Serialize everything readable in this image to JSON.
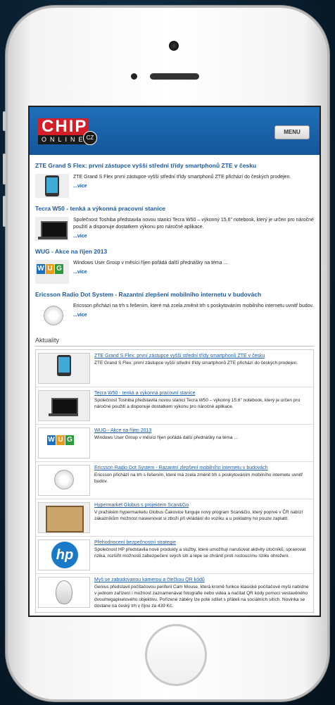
{
  "header": {
    "logo_main": "CHIP",
    "logo_sub": "ONLINE",
    "logo_badge": "CZ",
    "menu_label": "MENU"
  },
  "featured": [
    {
      "title": "ZTE Grand S Flex: první zástupce vyšší střední třídy smartphonů ZTE v česku",
      "text": "ZTE Grand S Flex první zástupce vyšší střední třídy smartphonů ZTE přichází do českých prodejen.",
      "more": "...více",
      "icon": "phone-image"
    },
    {
      "title": "Tecra W50 - tenká a výkonná pracovní stanice",
      "text": "Společnost Toshiba představila novou stanici Tecra W50 – výkonný 15.6\" notebook, který je určen pro náročné použití a disponuje dostatkem výkonu pro náročné aplikace.",
      "more": "...více",
      "icon": "laptop-image"
    },
    {
      "title": "WUG - Akce na říjen 2013",
      "text": "Windows User Group v měsíci říjen pořádá další přednášky na téma ...",
      "more": "...více",
      "icon": "wug-logo"
    },
    {
      "title": "Ericsson Radio Dot System - Razantní zlepšení mobilního internetu v budovách",
      "text": "Ericsson přichází na trh s řešením, které má zcela změnit trh s poskytováním mobilního internetu uvnitř budov.",
      "more": "...více",
      "icon": "radio-dot-image"
    }
  ],
  "aktuality": {
    "heading": "Aktuality",
    "items": [
      {
        "title": "ZTE Grand S Flex: první zástupce vyšší střední třídy smartphonů ZTE v česku",
        "text": "ZTE Grand S Flex: první zástupce vyšší střední třídy smartphonů ZTE přichází do českých prodejen.",
        "icon": "phone-image"
      },
      {
        "title": "Tecra W50 - tenká a výkonná pracovní stanice",
        "text": "Společnost Toshiba představila novou stanici Tecra W50 – výkonný 15.6\" notebook, který je určen pro náročné použití a disponuje dostatkem výkonu pro náročné aplikace.",
        "icon": "laptop-image"
      },
      {
        "title": "WUG - Akce na říjen 2013",
        "text": "Windows User Group v měsíci říjen pořádá další přednášky na téma ...",
        "icon": "wug-logo"
      },
      {
        "title": "Ericsson Radio Dot System - Razantní zlepšení mobilního internetu v budovách",
        "text": "Ericsson přichází na trh s řešením, které má zcela změnit trh s poskytováním mobilního internetu uvnitř budov.",
        "icon": "radio-dot-image"
      },
      {
        "title": "Hypermarket Globus s projektem Scan&Go",
        "text": "V pražském hypermarketu Globus Čakovice funguje nový program Scan&Go, který poprvé v ČR nabízí zákazníkům možnost naskenovat si zboží při vkládání do vozíku a u pokladny ho pouze zaplatit.",
        "icon": "globus-image"
      },
      {
        "title": "Přehodnocení bezpečnostní strategie",
        "text": "Společnost HP představila nové produkty a služby, které umožňují narušovat aktivity útočníků, spravovat rizika, rozšířit možnosti zabezpečení svých sítí a lépe se chránit proti rostoucímu riziku ohrožení.",
        "icon": "hp-logo"
      },
      {
        "title": "Myš se zabudovanou kamerou a čtečkou QR kódů",
        "text": "Genius představil počítačovou periferii Cam Mouse, která kromě funkce klasické počítačové myši nabídne v jednom zařízení i možnost zaznamenávat fotografie nebo videa a načítat QR kódy pomocí vestavěného dvoumegapixelového objektivu. Pořízené záběry lze poté sdílet s přáteli na sociálních sítích. Novinka se dostane na český trh v říjnu za 439 Kč.",
        "icon": "mouse-image"
      }
    ]
  },
  "colors": {
    "header_blue": "#1e6fb8",
    "link_blue": "#1d5aa6",
    "logo_red": "#d51f26"
  }
}
